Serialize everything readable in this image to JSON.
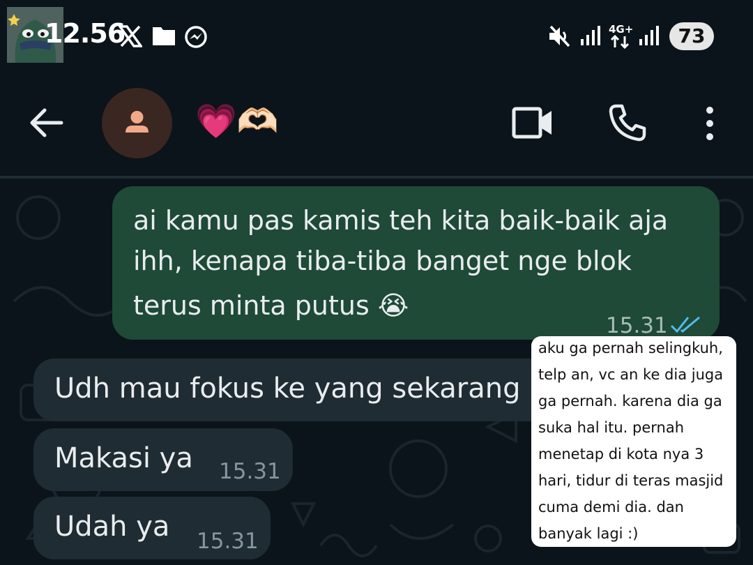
{
  "status_bar": {
    "time": "12.56",
    "battery": "73",
    "icons": [
      "x-logo-icon",
      "folder-icon",
      "messenger-icon",
      "mute-icon",
      "signal-icon",
      "4g-icon",
      "signal-icon"
    ]
  },
  "header": {
    "contact_name": "💗🫶🏻",
    "actions": [
      "video-call-icon",
      "phone-icon",
      "more-options-icon"
    ]
  },
  "messages": [
    {
      "direction": "outgoing",
      "lines": [
        "ai kamu pas kamis teh kita baik-baik aja",
        "ihh, kenapa tiba-tiba banget nge blok",
        "terus minta putus 😭"
      ],
      "time": "15.31",
      "status": "read"
    },
    {
      "direction": "incoming",
      "text": "Udh mau fokus ke yang sekarang",
      "time": ""
    },
    {
      "direction": "incoming",
      "text": "Makasi ya",
      "time": "15.31"
    },
    {
      "direction": "incoming",
      "text": "Udah ya",
      "time": "15.31"
    }
  ],
  "overlay_note": {
    "lines": [
      "aku ga pernah selingkuh,",
      "telp an, vc an ke dia juga",
      "ga pernah. karena dia ga",
      "suka hal itu. pernah",
      "menetap di kota nya 3",
      "hari, tidur di teras masjid",
      "cuma demi dia. dan",
      "banyak lagi :)"
    ]
  },
  "colors": {
    "background": "#0b141a",
    "outgoing_bubble": "#1e4a37",
    "incoming_bubble": "#1f2c33",
    "read_ticks": "#53bdeb",
    "note_bg": "#ffffff"
  }
}
